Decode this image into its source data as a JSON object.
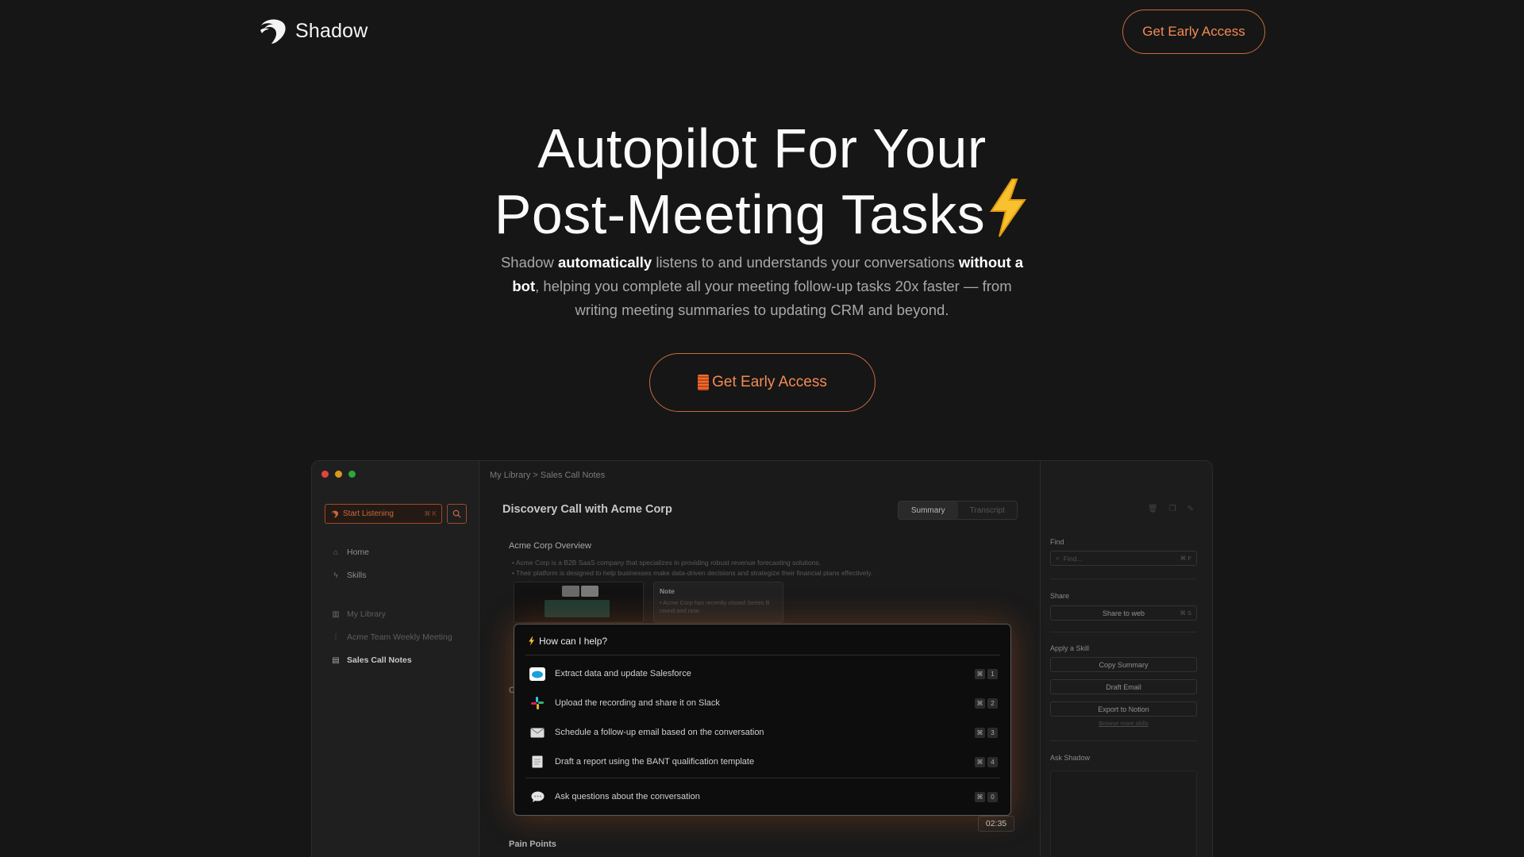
{
  "nav": {
    "brand": "Shadow",
    "cta_label": "Get Early Access"
  },
  "hero": {
    "title_line1": "Autopilot For Your",
    "title_line2": "Post-Meeting Tasks",
    "sub_1": "Shadow ",
    "sub_bold_1": "automatically",
    "sub_2": " listens to and understands your conversations ",
    "sub_bold_2": "without a bot",
    "sub_3": ", helping you complete all your meeting follow-up tasks 20x faster — from writing meeting summaries to updating CRM and beyond.",
    "cta_label": "Get Early Access"
  },
  "app": {
    "breadcrumb": "My Library > Sales Call Notes",
    "sidebar": {
      "start_label": "Start Listening",
      "start_kbd": "⌘ K",
      "items": [
        {
          "label": "Home"
        },
        {
          "label": "Skills"
        },
        {
          "label": "My Library"
        },
        {
          "label": "Acme Team Weekly Meeting"
        },
        {
          "label": "Sales Call Notes"
        }
      ]
    },
    "doc": {
      "title": "Discovery Call with Acme Corp",
      "tab_summary": "Summary",
      "tab_transcript": "Transcript",
      "overview_heading": "Acme Corp Overview",
      "bullet_1": "• Acme Corp is a B2B SaaS company that specializes in providing robust revenue forecasting solutions.",
      "bullet_2": "• Their platform is designed to help businesses make data-driven decisions and strategize their financial plans effectively.",
      "note_title": "Note",
      "note_body": "• Acme Corp has recently closed Series B round and now",
      "fragment": "C",
      "time": "02:35",
      "pain_heading": "Pain Points"
    },
    "right_panel": {
      "find_label": "Find",
      "find_placeholder": "Find...",
      "find_kbd": "⌘ F",
      "share_label": "Share",
      "share_button": "Share to web",
      "share_kbd": "⌘ S",
      "skill_label": "Apply a Skill",
      "skills": [
        "Copy Summary",
        "Draft Email",
        "Export to Notion"
      ],
      "browse_link": "Browse more skills",
      "ask_label": "Ask Shadow"
    },
    "palette": {
      "title": "How can I help?",
      "items": [
        {
          "label": "Extract data and update Salesforce",
          "key": "1",
          "icon": "salesforce-icon"
        },
        {
          "label": "Upload the recording and share it on Slack",
          "key": "2",
          "icon": "slack-icon"
        },
        {
          "label": "Schedule a follow-up email based on the conversation",
          "key": "3",
          "icon": "email-icon"
        },
        {
          "label": "Draft a report using the BANT qualification template",
          "key": "4",
          "icon": "report-icon"
        },
        {
          "label": "Ask questions about the conversation",
          "key": "0",
          "icon": "chat-icon"
        }
      ],
      "cmd_symbol": "⌘"
    }
  },
  "colors": {
    "background": "#161616",
    "accent": "#f48a55",
    "accent_border": "#c76a3c"
  }
}
